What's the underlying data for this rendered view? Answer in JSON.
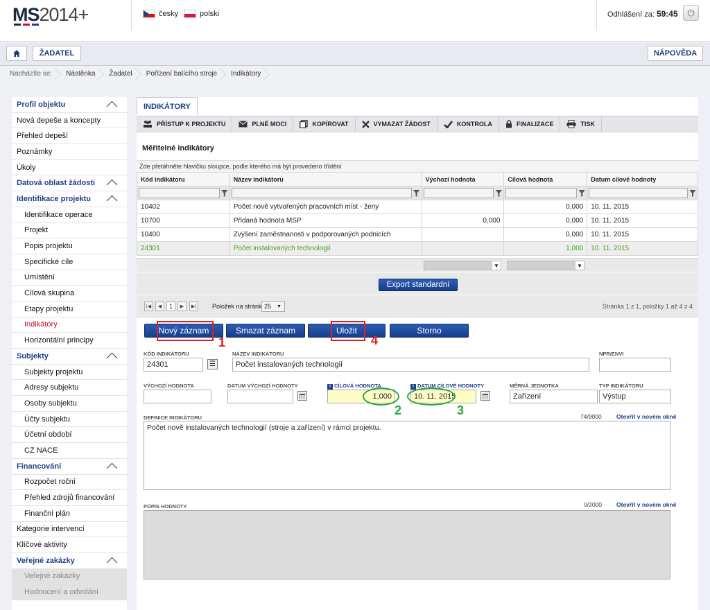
{
  "header": {
    "logo_main": "MS",
    "logo_year": "2014+",
    "lang_cz": "česky",
    "lang_pl": "polski",
    "logout_label": "Odhlášení za:",
    "logout_time": "59:45"
  },
  "nav": {
    "home_icon": "home-icon",
    "applicant": "ŽADATEL",
    "help": "NÁPOVĚDA"
  },
  "breadcrumb": [
    "Nacházíte se:",
    "Nástěnka",
    "Žadatel",
    "Pořízení balícího stroje",
    "Indikátory"
  ],
  "sidebar": [
    {
      "label": "Profil objektu",
      "type": "section"
    },
    {
      "label": "Nová depeše a koncepty",
      "type": "item"
    },
    {
      "label": "Přehled depeší",
      "type": "item"
    },
    {
      "label": "Poznámky",
      "type": "item"
    },
    {
      "label": "Úkoly",
      "type": "item"
    },
    {
      "label": "Datová oblast žádosti",
      "type": "section"
    },
    {
      "label": "Identifikace projektu",
      "type": "section"
    },
    {
      "label": "Identifikace operace",
      "type": "sub"
    },
    {
      "label": "Projekt",
      "type": "sub"
    },
    {
      "label": "Popis projektu",
      "type": "sub"
    },
    {
      "label": "Specifické cíle",
      "type": "sub"
    },
    {
      "label": "Umístění",
      "type": "sub"
    },
    {
      "label": "Cílová skupina",
      "type": "sub"
    },
    {
      "label": "Etapy projektu",
      "type": "sub"
    },
    {
      "label": "Indikátory",
      "type": "sub-active"
    },
    {
      "label": "Horizontální principy",
      "type": "sub"
    },
    {
      "label": "Subjekty",
      "type": "section"
    },
    {
      "label": "Subjekty projektu",
      "type": "sub"
    },
    {
      "label": "Adresy subjektu",
      "type": "sub"
    },
    {
      "label": "Osoby subjektu",
      "type": "sub"
    },
    {
      "label": "Účty subjektu",
      "type": "sub"
    },
    {
      "label": "Účetní období",
      "type": "sub"
    },
    {
      "label": "CZ NACE",
      "type": "sub"
    },
    {
      "label": "Financování",
      "type": "section"
    },
    {
      "label": "Rozpočet roční",
      "type": "sub"
    },
    {
      "label": "Přehled zdrojů financování",
      "type": "sub"
    },
    {
      "label": "Finanční plán",
      "type": "sub"
    },
    {
      "label": "Kategorie intervencí",
      "type": "item"
    },
    {
      "label": "Klíčové aktivity",
      "type": "item"
    },
    {
      "label": "Veřejné zakázky",
      "type": "section"
    },
    {
      "label": "Veřejné zakázky",
      "type": "sub-dim"
    },
    {
      "label": "Hodnocení a odvolání",
      "type": "sub-dim"
    }
  ],
  "tab": "INDIKÁTORY",
  "toolbar": [
    {
      "label": "PŘÍSTUP K PROJEKTU",
      "icon": "people-icon"
    },
    {
      "label": "PLNÉ MOCI",
      "icon": "envelope-icon"
    },
    {
      "label": "KOPÍROVAT",
      "icon": "copy-icon"
    },
    {
      "label": "VYMAZAT ŽÁDOST",
      "icon": "x-icon"
    },
    {
      "label": "KONTROLA",
      "icon": "check-icon"
    },
    {
      "label": "FINALIZACE",
      "icon": "lock-icon"
    },
    {
      "label": "TISK",
      "icon": "printer-icon"
    }
  ],
  "grid": {
    "title": "Měřitelné indikátory",
    "hint": "Zde přetáhněte hlavičku sloupce, podle kterého má být provedeno třídění",
    "columns": [
      "Kód indikátoru",
      "Název indikátoru",
      "Výchozí hodnota",
      "Cílová hodnota",
      "Datum cílové hodnoty"
    ],
    "rows": [
      [
        "10402",
        "Počet nově vytvořených pracovních míst - ženy",
        "",
        "0,000",
        "10. 11. 2015"
      ],
      [
        "10700",
        "Přidaná hodnota MSP",
        "0,000",
        "0,000",
        "10. 11. 2015"
      ],
      [
        "10400",
        "Zvýšení zaměstnanosti v podporovaných podnicích",
        "",
        "0,000",
        "10. 11. 2015"
      ],
      [
        "24301",
        "Počet instalovaných technologií",
        "",
        "1,000",
        "10. 11. 2015"
      ]
    ],
    "export": "Export standardní",
    "page_current": "1",
    "page_size_label": "Položek na stránku",
    "page_size": "25",
    "page_info": "Stránka 1 z 1, položky 1 až 4 z 4"
  },
  "actions": {
    "new": "Nový záznam",
    "delete": "Smazat záznam",
    "save": "Uložit",
    "cancel": "Storno"
  },
  "form": {
    "code_label": "KÓD INDIKÁTORU",
    "code": "24301",
    "name_label": "NÁZEV INDIKÁTORU",
    "name": "Počet instalovaných technologií",
    "npr_label": "NPR/ENVI",
    "npr": "",
    "start_label": "VÝCHOZÍ HODNOTA",
    "start": "",
    "start_date_label": "DATUM VÝCHOZÍ HODNOTY",
    "start_date": "",
    "target_label": "CÍLOVÁ HODNOTA",
    "target": "1,000",
    "target_date_label": "DATUM CÍLOVÉ HODNOTY",
    "target_date": "10. 11. 2015",
    "unit_label": "MĚRNÁ JEDNOTKA",
    "unit": "Zařízení",
    "type_label": "TYP INDIKÁTORU",
    "type": "Výstup",
    "definition_label": "DEFINICE INDIKÁTORU",
    "definition_count": "74/9000",
    "open_new": "Otevřít v novém okně",
    "definition": "Počet nově instalovaných technologií (stroje a zařízení) v rámci projektu.",
    "desc_label": "POPIS HODNOTY",
    "desc_count": "0/2000",
    "desc": ""
  },
  "annotations": {
    "a1": "1",
    "a2": "2",
    "a3": "3",
    "a4": "4"
  },
  "colors": {
    "accent": "#1f3f8a",
    "red": "#e02020",
    "green": "#27a845",
    "rowgreen": "#4a9e2b"
  }
}
